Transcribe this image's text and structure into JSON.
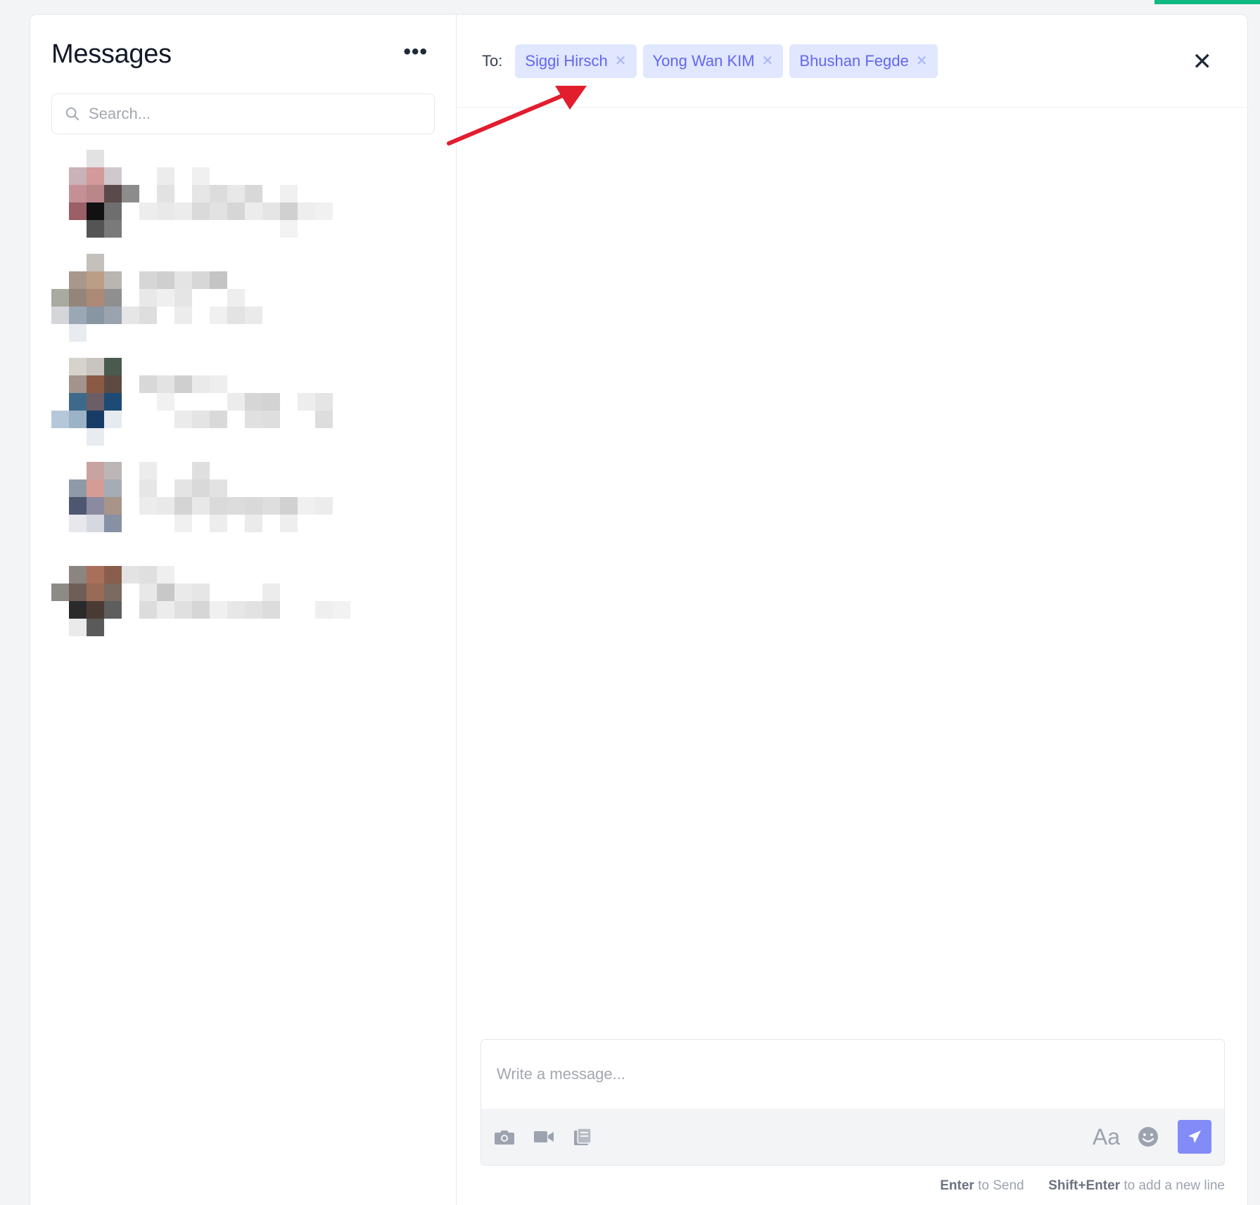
{
  "sidebar": {
    "title": "Messages",
    "more_icon": "ellipsis-icon",
    "search": {
      "placeholder": "Search..."
    },
    "conversations_count_visible": 5
  },
  "chat": {
    "to_label": "To:",
    "recipients": [
      {
        "name": "Siggi Hirsch"
      },
      {
        "name": "Yong Wan KIM"
      },
      {
        "name": "Bhushan Fegde"
      }
    ],
    "composer": {
      "placeholder": "Write a message...",
      "font_toggle": "Aa"
    },
    "hint": {
      "enter_key": "Enter",
      "enter_text": "to Send",
      "shift_key": "Shift+Enter",
      "shift_text": "to add a new line"
    }
  },
  "colors": {
    "chip_bg": "#e0e7ff",
    "chip_text": "#6366f1",
    "send_button": "#818cf8",
    "annotation_arrow": "#e11d2e",
    "top_accent": "#10b981"
  }
}
